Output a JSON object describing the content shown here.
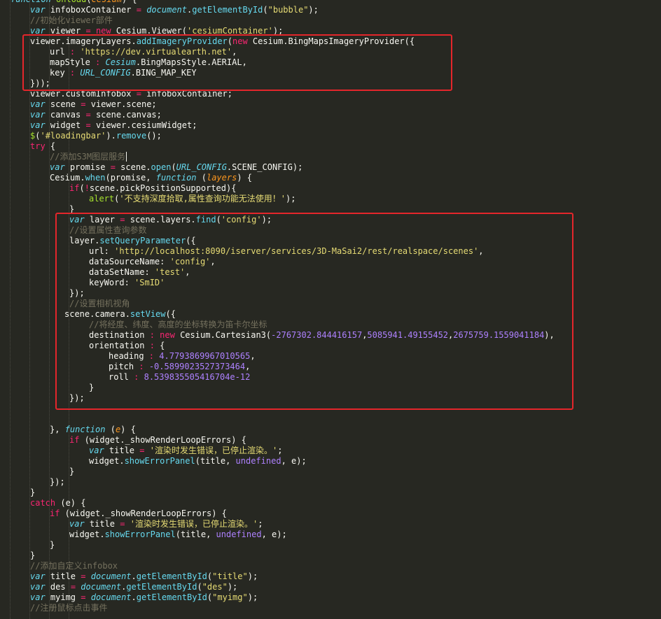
{
  "editor": {
    "lines": [
      {
        "indent": 0,
        "tokens": [
          [
            "function",
            "kw"
          ],
          [
            " ",
            "plain"
          ],
          [
            "onload",
            "fn"
          ],
          [
            "(",
            "plain"
          ],
          [
            "Cesium",
            "param"
          ],
          [
            ") {",
            "plain"
          ]
        ]
      },
      {
        "indent": 1,
        "tokens": [
          [
            "var",
            "kw"
          ],
          [
            " infoboxContainer ",
            "plain"
          ],
          [
            "=",
            "op"
          ],
          [
            " ",
            "plain"
          ],
          [
            "document",
            "glob"
          ],
          [
            ".",
            "plain"
          ],
          [
            "getElementById",
            "call"
          ],
          [
            "(",
            "plain"
          ],
          [
            "\"bubble\"",
            "str"
          ],
          [
            ");",
            "plain"
          ]
        ]
      },
      {
        "indent": 1,
        "tokens": [
          [
            "//初始化viewer部件",
            "cm"
          ]
        ]
      },
      {
        "indent": 1,
        "tokens": [
          [
            "var",
            "kw"
          ],
          [
            " viewer ",
            "plain"
          ],
          [
            "=",
            "op"
          ],
          [
            " ",
            "plain"
          ],
          [
            "new",
            "new"
          ],
          [
            " Cesium.Viewer(",
            "plain"
          ],
          [
            "'cesiumContainer'",
            "str"
          ],
          [
            ");",
            "plain"
          ]
        ]
      },
      {
        "indent": 1,
        "tokens": [
          [
            "viewer.imageryLayers.",
            "plain"
          ],
          [
            "addImageryProvider",
            "call"
          ],
          [
            "(",
            "plain"
          ],
          [
            "new",
            "new"
          ],
          [
            " Cesium.BingMapsImageryProvider({",
            "plain"
          ]
        ]
      },
      {
        "indent": 2,
        "tokens": [
          [
            "url ",
            "plain"
          ],
          [
            ":",
            "op"
          ],
          [
            " ",
            "plain"
          ],
          [
            "'https://dev.virtualearth.net'",
            "str"
          ],
          [
            ",",
            "plain"
          ]
        ]
      },
      {
        "indent": 2,
        "tokens": [
          [
            "mapStyle ",
            "plain"
          ],
          [
            ":",
            "op"
          ],
          [
            " ",
            "plain"
          ],
          [
            "Cesium",
            "glob"
          ],
          [
            ".BingMapsStyle.AERIAL,",
            "plain"
          ]
        ]
      },
      {
        "indent": 2,
        "tokens": [
          [
            "key ",
            "plain"
          ],
          [
            ":",
            "op"
          ],
          [
            " ",
            "plain"
          ],
          [
            "URL_CONFIG",
            "glob"
          ],
          [
            ".BING_MAP_KEY",
            "plain"
          ]
        ]
      },
      {
        "indent": 1,
        "tokens": [
          [
            "}));",
            "plain"
          ]
        ]
      },
      {
        "indent": 1,
        "tokens": [
          [
            "viewer.customInfobox ",
            "plain"
          ],
          [
            "=",
            "op"
          ],
          [
            " infoboxContainer;",
            "plain"
          ]
        ]
      },
      {
        "indent": 1,
        "tokens": [
          [
            "var",
            "kw"
          ],
          [
            " scene ",
            "plain"
          ],
          [
            "=",
            "op"
          ],
          [
            " viewer.scene;",
            "plain"
          ]
        ]
      },
      {
        "indent": 1,
        "tokens": [
          [
            "var",
            "kw"
          ],
          [
            " canvas ",
            "plain"
          ],
          [
            "=",
            "op"
          ],
          [
            " scene.canvas;",
            "plain"
          ]
        ]
      },
      {
        "indent": 1,
        "tokens": [
          [
            "var",
            "kw"
          ],
          [
            " widget ",
            "plain"
          ],
          [
            "=",
            "op"
          ],
          [
            " viewer.cesiumWidget;",
            "plain"
          ]
        ]
      },
      {
        "indent": 1,
        "tokens": [
          [
            "$",
            "fn"
          ],
          [
            "(",
            "plain"
          ],
          [
            "'#loadingbar'",
            "str"
          ],
          [
            ").",
            "plain"
          ],
          [
            "remove",
            "call"
          ],
          [
            "();",
            "plain"
          ]
        ]
      },
      {
        "indent": 1,
        "tokens": [
          [
            "try",
            "ctrl"
          ],
          [
            " {",
            "plain"
          ]
        ]
      },
      {
        "indent": 2,
        "tokens": [
          [
            "//添加S3M图层服务",
            "cm"
          ]
        ]
      },
      {
        "indent": 2,
        "tokens": [
          [
            "var",
            "kw"
          ],
          [
            " promise ",
            "plain"
          ],
          [
            "=",
            "op"
          ],
          [
            " scene.",
            "plain"
          ],
          [
            "open",
            "call"
          ],
          [
            "(",
            "plain"
          ],
          [
            "URL_CONFIG",
            "glob"
          ],
          [
            ".SCENE_CONFIG);",
            "plain"
          ]
        ]
      },
      {
        "indent": 2,
        "tokens": [
          [
            "Cesium.",
            "plain"
          ],
          [
            "when",
            "call"
          ],
          [
            "(promise, ",
            "plain"
          ],
          [
            "function",
            "kw"
          ],
          [
            " (",
            "plain"
          ],
          [
            "layers",
            "param"
          ],
          [
            ") {",
            "plain"
          ]
        ]
      },
      {
        "indent": 3,
        "tokens": [
          [
            "if",
            "ctrl"
          ],
          [
            "(",
            "plain"
          ],
          [
            "!",
            "op"
          ],
          [
            "scene.pickPositionSupported){",
            "plain"
          ]
        ]
      },
      {
        "indent": 4,
        "tokens": [
          [
            "alert",
            "fn"
          ],
          [
            "(",
            "plain"
          ],
          [
            "'不支持深度拾取,属性查询功能无法使用！'",
            "str"
          ],
          [
            ");",
            "plain"
          ]
        ]
      },
      {
        "indent": 3,
        "tokens": [
          [
            "}",
            "plain"
          ]
        ]
      },
      {
        "indent": 3,
        "tokens": [
          [
            "var",
            "kw"
          ],
          [
            " layer ",
            "plain"
          ],
          [
            "=",
            "op"
          ],
          [
            " scene.layers.",
            "plain"
          ],
          [
            "find",
            "call"
          ],
          [
            "(",
            "plain"
          ],
          [
            "'config'",
            "str"
          ],
          [
            ");",
            "plain"
          ]
        ]
      },
      {
        "indent": 3,
        "tokens": [
          [
            "//设置属性查询参数",
            "cm"
          ]
        ]
      },
      {
        "indent": 3,
        "tokens": [
          [
            "layer.",
            "plain"
          ],
          [
            "setQueryParameter",
            "call"
          ],
          [
            "({",
            "plain"
          ]
        ]
      },
      {
        "indent": 4,
        "tokens": [
          [
            "url: ",
            "plain"
          ],
          [
            "'http://localhost:8090/iserver/services/3D-MaSai2/rest/realspace/scenes'",
            "str"
          ],
          [
            ",",
            "plain"
          ]
        ]
      },
      {
        "indent": 4,
        "tokens": [
          [
            "dataSourceName: ",
            "plain"
          ],
          [
            "'config'",
            "str"
          ],
          [
            ",",
            "plain"
          ]
        ]
      },
      {
        "indent": 4,
        "tokens": [
          [
            "dataSetName: ",
            "plain"
          ],
          [
            "'test'",
            "str"
          ],
          [
            ",",
            "plain"
          ]
        ]
      },
      {
        "indent": 4,
        "tokens": [
          [
            "keyWord: ",
            "plain"
          ],
          [
            "'SmID'",
            "str"
          ]
        ]
      },
      {
        "indent": 3,
        "tokens": [
          [
            "});",
            "plain"
          ]
        ]
      },
      {
        "indent": 3,
        "tokens": [
          [
            "//设置相机视角",
            "cm"
          ]
        ]
      },
      {
        "indent": 2.75,
        "tokens": [
          [
            "scene.camera.",
            "plain"
          ],
          [
            "setView",
            "call"
          ],
          [
            "({",
            "plain"
          ]
        ]
      },
      {
        "indent": 4,
        "tokens": [
          [
            "//将经度、纬度、高度的坐标转换为笛卡尔坐标",
            "cm"
          ]
        ]
      },
      {
        "indent": 4,
        "tokens": [
          [
            "destination ",
            "plain"
          ],
          [
            ":",
            "op"
          ],
          [
            " ",
            "plain"
          ],
          [
            "new",
            "new"
          ],
          [
            " Cesium.Cartesian3(",
            "plain"
          ],
          [
            "-2767302.844416157",
            "const"
          ],
          [
            ",",
            "plain"
          ],
          [
            "5085941.49155452",
            "const"
          ],
          [
            ",",
            "plain"
          ],
          [
            "2675759.1559041184",
            "const"
          ],
          [
            "),",
            "plain"
          ]
        ]
      },
      {
        "indent": 4,
        "tokens": [
          [
            "orientation ",
            "plain"
          ],
          [
            ":",
            "op"
          ],
          [
            " {",
            "plain"
          ]
        ]
      },
      {
        "indent": 5,
        "tokens": [
          [
            "heading ",
            "plain"
          ],
          [
            ":",
            "op"
          ],
          [
            " ",
            "plain"
          ],
          [
            "4.7793869967010565",
            "num"
          ],
          [
            ",",
            "plain"
          ]
        ]
      },
      {
        "indent": 5,
        "tokens": [
          [
            "pitch ",
            "plain"
          ],
          [
            ":",
            "op"
          ],
          [
            " ",
            "plain"
          ],
          [
            "-0.5899023527373464",
            "num"
          ],
          [
            ",",
            "plain"
          ]
        ]
      },
      {
        "indent": 5,
        "tokens": [
          [
            "roll ",
            "plain"
          ],
          [
            ":",
            "op"
          ],
          [
            " ",
            "plain"
          ],
          [
            "8.539835505416704e-12",
            "num"
          ]
        ]
      },
      {
        "indent": 4,
        "tokens": [
          [
            "}",
            "plain"
          ]
        ]
      },
      {
        "indent": 3,
        "tokens": [
          [
            "});",
            "plain"
          ]
        ]
      },
      {
        "indent": 0,
        "tokens": []
      },
      {
        "indent": 0,
        "tokens": []
      },
      {
        "indent": 2,
        "tokens": [
          [
            "}, ",
            "plain"
          ],
          [
            "function",
            "kw"
          ],
          [
            " (",
            "plain"
          ],
          [
            "e",
            "param"
          ],
          [
            ") {",
            "plain"
          ]
        ]
      },
      {
        "indent": 3,
        "tokens": [
          [
            "if",
            "ctrl"
          ],
          [
            " (widget._showRenderLoopErrors) {",
            "plain"
          ]
        ]
      },
      {
        "indent": 4,
        "tokens": [
          [
            "var",
            "kw"
          ],
          [
            " title ",
            "plain"
          ],
          [
            "=",
            "op"
          ],
          [
            " ",
            "plain"
          ],
          [
            "'渲染时发生错误，已停止渲染。'",
            "str"
          ],
          [
            ";",
            "plain"
          ]
        ]
      },
      {
        "indent": 4,
        "tokens": [
          [
            "widget.",
            "plain"
          ],
          [
            "showErrorPanel",
            "call"
          ],
          [
            "(title, ",
            "plain"
          ],
          [
            "undefined",
            "const"
          ],
          [
            ", e);",
            "plain"
          ]
        ]
      },
      {
        "indent": 3,
        "tokens": [
          [
            "}",
            "plain"
          ]
        ]
      },
      {
        "indent": 2,
        "tokens": [
          [
            "});",
            "plain"
          ]
        ]
      },
      {
        "indent": 1,
        "tokens": [
          [
            "}",
            "plain"
          ]
        ]
      },
      {
        "indent": 1,
        "tokens": [
          [
            "catch",
            "ctrl"
          ],
          [
            " (e) {",
            "plain"
          ]
        ]
      },
      {
        "indent": 2,
        "tokens": [
          [
            "if",
            "ctrl"
          ],
          [
            " (widget._showRenderLoopErrors) {",
            "plain"
          ]
        ]
      },
      {
        "indent": 3,
        "tokens": [
          [
            "var",
            "kw"
          ],
          [
            " title ",
            "plain"
          ],
          [
            "=",
            "op"
          ],
          [
            " ",
            "plain"
          ],
          [
            "'渲染时发生错误，已停止渲染。'",
            "str"
          ],
          [
            ";",
            "plain"
          ]
        ]
      },
      {
        "indent": 3,
        "tokens": [
          [
            "widget.",
            "plain"
          ],
          [
            "showErrorPanel",
            "call"
          ],
          [
            "(title, ",
            "plain"
          ],
          [
            "undefined",
            "const"
          ],
          [
            ", e);",
            "plain"
          ]
        ]
      },
      {
        "indent": 2,
        "tokens": [
          [
            "}",
            "plain"
          ]
        ]
      },
      {
        "indent": 1,
        "tokens": [
          [
            "}",
            "plain"
          ]
        ]
      },
      {
        "indent": 1,
        "tokens": [
          [
            "//添加自定义infobox",
            "cm"
          ]
        ]
      },
      {
        "indent": 1,
        "tokens": [
          [
            "var",
            "kw"
          ],
          [
            " title ",
            "plain"
          ],
          [
            "=",
            "op"
          ],
          [
            " ",
            "plain"
          ],
          [
            "document",
            "glob"
          ],
          [
            ".",
            "plain"
          ],
          [
            "getElementById",
            "call"
          ],
          [
            "(",
            "plain"
          ],
          [
            "\"title\"",
            "str"
          ],
          [
            ");",
            "plain"
          ]
        ]
      },
      {
        "indent": 1,
        "tokens": [
          [
            "var",
            "kw"
          ],
          [
            " des ",
            "plain"
          ],
          [
            "=",
            "op"
          ],
          [
            " ",
            "plain"
          ],
          [
            "document",
            "glob"
          ],
          [
            ".",
            "plain"
          ],
          [
            "getElementById",
            "call"
          ],
          [
            "(",
            "plain"
          ],
          [
            "\"des\"",
            "str"
          ],
          [
            ");",
            "plain"
          ]
        ]
      },
      {
        "indent": 1,
        "tokens": [
          [
            "var",
            "kw"
          ],
          [
            " myimg ",
            "plain"
          ],
          [
            "=",
            "op"
          ],
          [
            " ",
            "plain"
          ],
          [
            "document",
            "glob"
          ],
          [
            ".",
            "plain"
          ],
          [
            "getElementById",
            "call"
          ],
          [
            "(",
            "plain"
          ],
          [
            "\"myimg\"",
            "str"
          ],
          [
            ");",
            "plain"
          ]
        ]
      },
      {
        "indent": 1,
        "tokens": [
          [
            "//注册鼠标点击事件",
            "cm"
          ]
        ]
      }
    ]
  },
  "highlights": [
    {
      "name": "highlight-box-imagery-provider",
      "from_line": 4,
      "to_line": 8
    },
    {
      "name": "highlight-box-query-and-camera",
      "from_line": 21,
      "to_line": 38
    }
  ],
  "colors": {
    "background": "#272822",
    "highlight_border": "#e4262b"
  }
}
